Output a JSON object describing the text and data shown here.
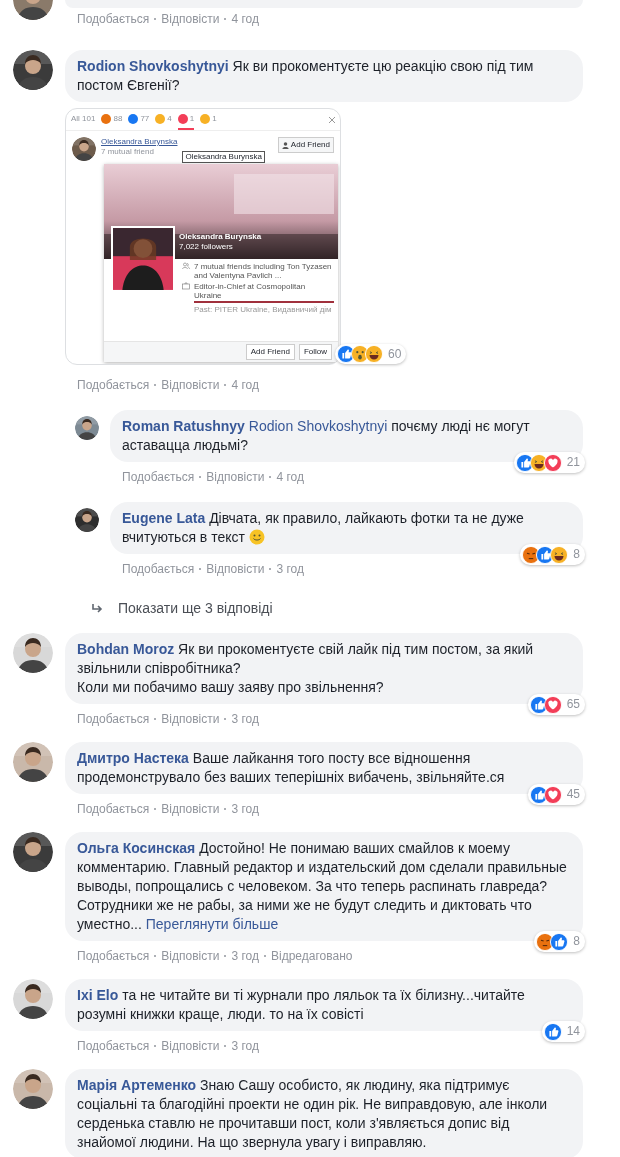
{
  "previous_comment": {
    "actions": [
      "Подобається",
      "Відповісти",
      "4 год"
    ]
  },
  "comments": [
    {
      "author": "Rodion Shovkoshytnyi",
      "text": "Як ви прокоментуєте цю реакцію свою під тим постом Євгенії?",
      "attachment": {
        "kind": "screenshot",
        "tabs": [
          {
            "kind": "all",
            "label": "All 101",
            "selected": false
          },
          {
            "kind": "angry",
            "label": "88",
            "selected": false
          },
          {
            "kind": "like",
            "label": "77",
            "selected": false
          },
          {
            "kind": "wow",
            "label": "4",
            "selected": false
          },
          {
            "kind": "love",
            "label": "1",
            "selected": true
          },
          {
            "kind": "haha",
            "label": "1",
            "selected": false
          }
        ],
        "person": {
          "name": "Oleksandra Burynska",
          "subtitle": "7 mutual friend",
          "tooltip": "Oleksandra Burynska",
          "button": "Add Friend"
        },
        "card": {
          "name": "Oleksandra Burynska",
          "followers": "7,022 followers",
          "mutual": "7 mutual friends including Ton Tyzasen and Valentyna Pavlich ...",
          "work": "Editor-in-Chief at Cosmopolitan Ukraine",
          "past": "Past: PITER Ukraine, Видавничий дім",
          "buttons": [
            "Add Friend",
            "Follow"
          ]
        },
        "reactions": {
          "icons": [
            {
              "kind": "like"
            },
            {
              "kind": "wow"
            },
            {
              "kind": "haha"
            }
          ],
          "count": "60"
        }
      },
      "actions": [
        "Подобається",
        "Відповісти",
        "4 год"
      ],
      "replies": [
        {
          "author": "Roman Ratushnyy",
          "mention": "Rodion Shovkoshytnyi",
          "text": "почєму люді нє могут аставацца людьмі?",
          "reactions": {
            "icons": [
              {
                "kind": "like"
              },
              {
                "kind": "haha"
              },
              {
                "kind": "love"
              }
            ],
            "count": "21"
          },
          "actions": [
            "Подобається",
            "Відповісти",
            "4 год"
          ]
        },
        {
          "author": "Eugene Lata",
          "text": "Дівчата, як правило, лайкають фотки та не дуже вчитуються в текст",
          "smiley": true,
          "reactions": {
            "icons": [
              {
                "kind": "angry"
              },
              {
                "kind": "like"
              },
              {
                "kind": "haha"
              }
            ],
            "count": "8"
          },
          "actions": [
            "Подобається",
            "Відповісти",
            "3 год"
          ]
        }
      ],
      "more_replies": "Показати ще 3 відповіді"
    },
    {
      "author": "Bohdan Moroz",
      "text": "Як ви прокоментуєте свій лайк під тим постом, за який звільнили співробітника?\nКоли ми побачимо вашу заяву про звільнення?",
      "reactions": {
        "icons": [
          {
            "kind": "like"
          },
          {
            "kind": "love"
          }
        ],
        "count": "65"
      },
      "actions": [
        "Подобається",
        "Відповісти",
        "3 год"
      ]
    },
    {
      "author": "Дмитро Настека",
      "text": "Ваше лайкання того посту все відношення продемонструвало без ваших теперішніх вибачень, звільняйте.ся",
      "reactions": {
        "icons": [
          {
            "kind": "like"
          },
          {
            "kind": "love"
          }
        ],
        "count": "45"
      },
      "actions": [
        "Подобається",
        "Відповісти",
        "3 год"
      ]
    },
    {
      "author": "Ольга Косинская",
      "text": "Достойно! Не понимаю ваших смайлов к моему комментарию. Главный редактор и издательский дом сделали правильные выводы, попрощались с человеком. За что теперь распинать главреда? Сотрудники же не рабы, за ними же не будут следить и диктовать что уместно...",
      "see_more": "Переглянути більше",
      "reactions": {
        "icons": [
          {
            "kind": "angry"
          },
          {
            "kind": "like"
          }
        ],
        "count": "8"
      },
      "actions": [
        "Подобається",
        "Відповісти",
        "3 год",
        "Відредаговано"
      ]
    },
    {
      "author": "Ixi Elo",
      "text": "та не читайте ви ті журнали про ляльок та їх білизну...читайте розумні книжки краще, люди. то на їх совісті",
      "reactions": {
        "icons": [
          {
            "kind": "like"
          }
        ],
        "count": "14"
      },
      "actions": [
        "Подобається",
        "Відповісти",
        "3 год"
      ]
    },
    {
      "author": "Марія Артеменко",
      "text": "Знаю Сашу особисто, як людину, яка підтримує соціальні та благодійні проекти не один рік. Не виправдовую, але інколи серденька ставлю не прочитавши пост, коли з'являється допис від знайомої людини. На що звернула увагу і виправляю."
    }
  ]
}
